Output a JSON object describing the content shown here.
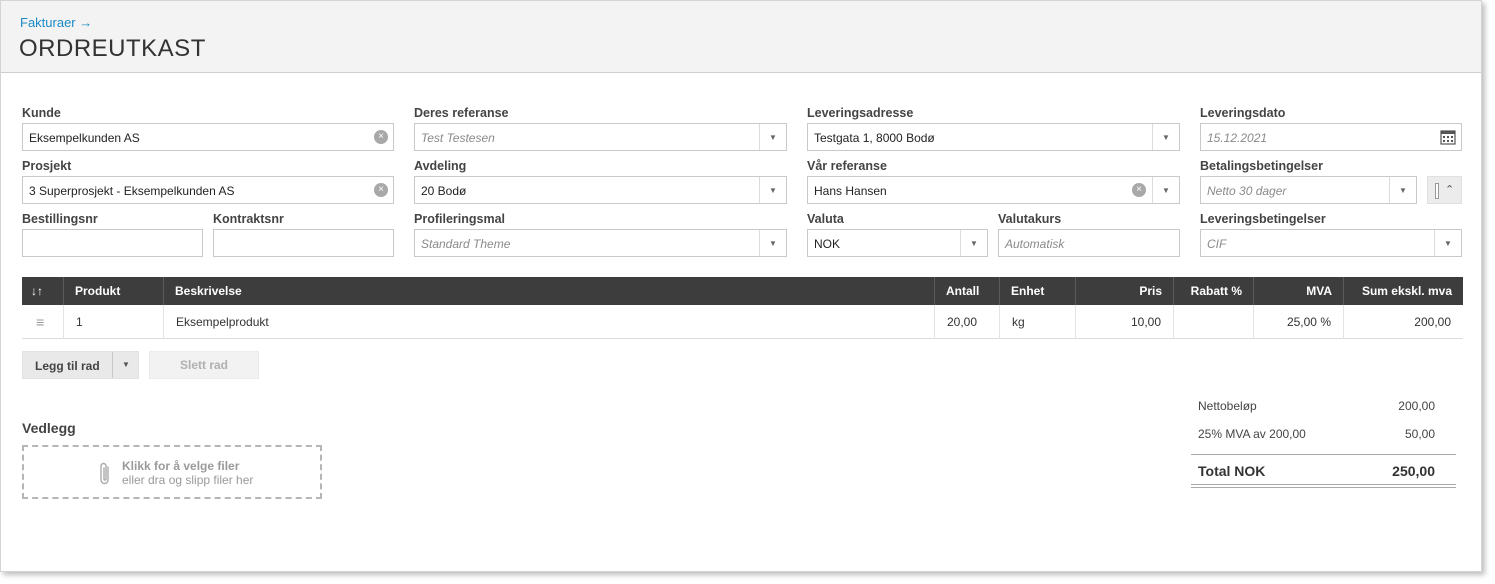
{
  "header": {
    "breadcrumb": "Fakturaer →",
    "title": "ORDREUTKAST"
  },
  "form": {
    "kunde": {
      "label": "Kunde",
      "value": "Eksempelkunden AS"
    },
    "deres_referanse": {
      "label": "Deres referanse",
      "placeholder": "Test Testesen"
    },
    "leveringsadresse": {
      "label": "Leveringsadresse",
      "value": "Testgata 1, 8000 Bodø"
    },
    "leveringsdato": {
      "label": "Leveringsdato",
      "placeholder": "15.12.2021"
    },
    "prosjekt": {
      "label": "Prosjekt",
      "value": "3 Superprosjekt - Eksempelkunden AS"
    },
    "avdeling": {
      "label": "Avdeling",
      "value": "20 Bodø"
    },
    "var_referanse": {
      "label": "Vår referanse",
      "value": "Hans Hansen"
    },
    "betalingsbetingelser": {
      "label": "Betalingsbetingelser",
      "placeholder": "Netto 30 dager"
    },
    "bestillingsnr": {
      "label": "Bestillingsnr",
      "value": ""
    },
    "kontraktsnr": {
      "label": "Kontraktsnr",
      "value": ""
    },
    "profileringsmal": {
      "label": "Profileringsmal",
      "placeholder": "Standard Theme"
    },
    "valuta": {
      "label": "Valuta",
      "value": "NOK"
    },
    "valutakurs": {
      "label": "Valutakurs",
      "placeholder": "Automatisk"
    },
    "leveringsbetingelser": {
      "label": "Leveringsbetingelser",
      "placeholder": "CIF"
    }
  },
  "table": {
    "headers": {
      "sort": "↓↑",
      "produkt": "Produkt",
      "beskrivelse": "Beskrivelse",
      "antall": "Antall",
      "enhet": "Enhet",
      "pris": "Pris",
      "rabatt": "Rabatt %",
      "mva": "MVA",
      "sum": "Sum ekskl. mva"
    },
    "rows": [
      {
        "produkt": "1",
        "beskrivelse": "Eksempelprodukt",
        "antall": "20,00",
        "enhet": "kg",
        "pris": "10,00",
        "rabatt": "",
        "mva": "25,00 %",
        "sum": "200,00"
      }
    ]
  },
  "actions": {
    "add_row": "Legg til rad",
    "delete_row": "Slett rad"
  },
  "attachments": {
    "title": "Vedlegg",
    "line1": "Klikk for å velge filer",
    "line2": "eller dra og slipp filer her"
  },
  "summary": {
    "netto_label": "Nettobeløp",
    "netto_value": "200,00",
    "mva_label": "25% MVA av 200,00",
    "mva_value": "50,00",
    "total_label": "Total NOK",
    "total_value": "250,00"
  },
  "colors": {
    "link": "#1a8ac6",
    "table_header": "#3d3d3d"
  }
}
